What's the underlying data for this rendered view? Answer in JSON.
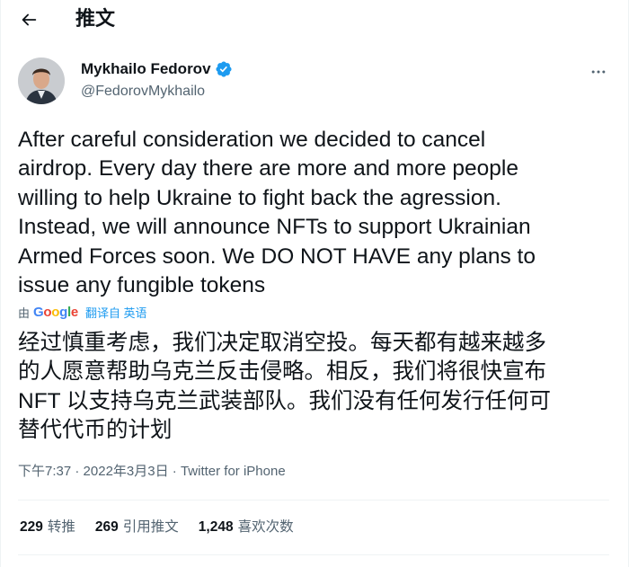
{
  "header": {
    "title": "推文"
  },
  "author": {
    "name": "Mykhailo Fedorov",
    "handle": "@FedorovMykhailo"
  },
  "tweet": {
    "text": "After careful consideration we decided to cancel\nairdrop. Every day there are more and more people\nwilling to help Ukraine to fight back the agression.\nInstead, we will announce NFTs to support Ukrainian\nArmed Forces soon. We DO NOT HAVE any plans to\nissue any fungible tokens",
    "translate_by": "由",
    "translate_provider": "Google",
    "translate_from": "翻译自 英语",
    "translation": "经过慎重考虑，我们决定取消空投。每天都有越来越多\n的人愿意帮助乌克兰反击侵略。相反，我们将很快宣布\nNFT 以支持乌克兰武装部队。我们没有任何发行任何可\n替代代币的计划",
    "time": "下午7:37",
    "separator1": " · ",
    "date": "2022年3月3日",
    "separator2": " · ",
    "source": "Twitter for iPhone"
  },
  "stats": [
    {
      "count": "229",
      "label": "转推"
    },
    {
      "count": "269",
      "label": "引用推文"
    },
    {
      "count": "1,248",
      "label": "喜欢次数"
    }
  ],
  "colors": {
    "accent": "#1d9bf0",
    "secondary_text": "#536471",
    "primary_text": "#0f1419"
  }
}
